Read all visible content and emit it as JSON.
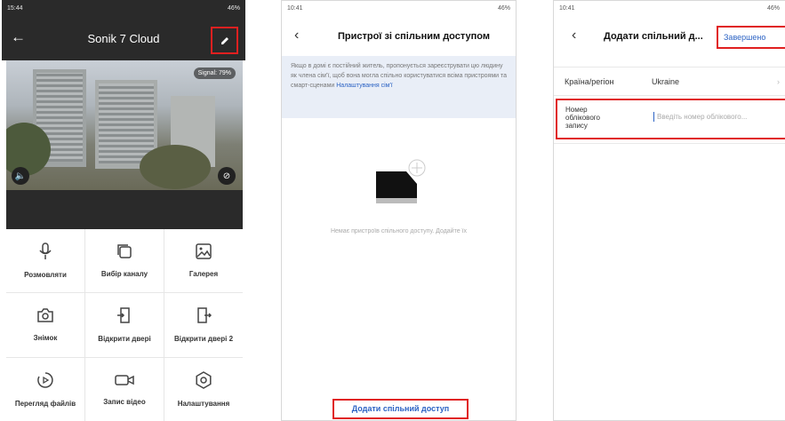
{
  "colors": {
    "accent": "#2c63c4",
    "highlight": "#e02020",
    "dark_bar": "#2a2a2a"
  },
  "screen1": {
    "status_time": "15:44",
    "status_right": "46%",
    "title": "Sonik 7 Cloud",
    "back_icon": "arrow-left-icon",
    "edit_icon": "pencil-icon",
    "signal": "Signal: 79%",
    "actions": [
      {
        "label": "Розмовляти",
        "icon": "microphone-icon"
      },
      {
        "label": "Вибір каналу",
        "icon": "channel-icon"
      },
      {
        "label": "Галерея",
        "icon": "gallery-icon"
      },
      {
        "label": "Знімок",
        "icon": "camera-icon"
      },
      {
        "label": "Відкрити двері",
        "icon": "door-icon"
      },
      {
        "label": "Відкрити двері 2",
        "icon": "door-icon"
      },
      {
        "label": "Перегляд файлів",
        "icon": "playback-icon"
      },
      {
        "label": "Запис відео",
        "icon": "video-record-icon"
      },
      {
        "label": "Налаштування",
        "icon": "gear-icon"
      }
    ]
  },
  "screen2": {
    "status_time": "10:41",
    "status_right": "46%",
    "title": "Пристрої зі спільним доступом",
    "info_text": "Якщо в домі є постійний житель, пропонується зареєструвати цю людину як члена сім'ї, щоб вона могла спільно користуватися всіма пристроями та смарт-сценами",
    "info_link": "Налаштування сім'ї",
    "empty_text": "Немає пристроїв спільного доступу. Додайте їх",
    "add_button": "Додати спільний доступ"
  },
  "screen3": {
    "status_time": "10:41",
    "status_right": "46%",
    "title": "Додати спільний д...",
    "done_button": "Завершено",
    "country_label": "Країна/регіон",
    "country_value": "Ukraine",
    "account_label": "Номер облікового запису",
    "account_placeholder": "Введіть номер облікового..."
  }
}
